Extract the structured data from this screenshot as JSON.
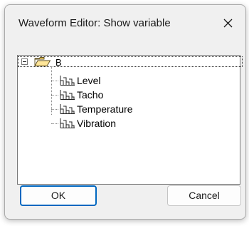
{
  "window": {
    "title": "Waveform Editor: Show variable",
    "close_icon": "close-icon"
  },
  "tree": {
    "root": {
      "label": "B",
      "expanded": true,
      "icon": "open-folder-icon"
    },
    "items": [
      {
        "label": "Level",
        "icon": "waveform-variable-icon"
      },
      {
        "label": "Tacho",
        "icon": "waveform-variable-icon"
      },
      {
        "label": "Temperature",
        "icon": "waveform-variable-icon"
      },
      {
        "label": "Vibration",
        "icon": "waveform-variable-icon"
      }
    ]
  },
  "buttons": {
    "ok_label": "OK",
    "cancel_label": "Cancel"
  },
  "colors": {
    "dialog_bg": "#f0f0f0",
    "focus_accent": "#0067c0",
    "folder_fill": "#ffd966"
  }
}
